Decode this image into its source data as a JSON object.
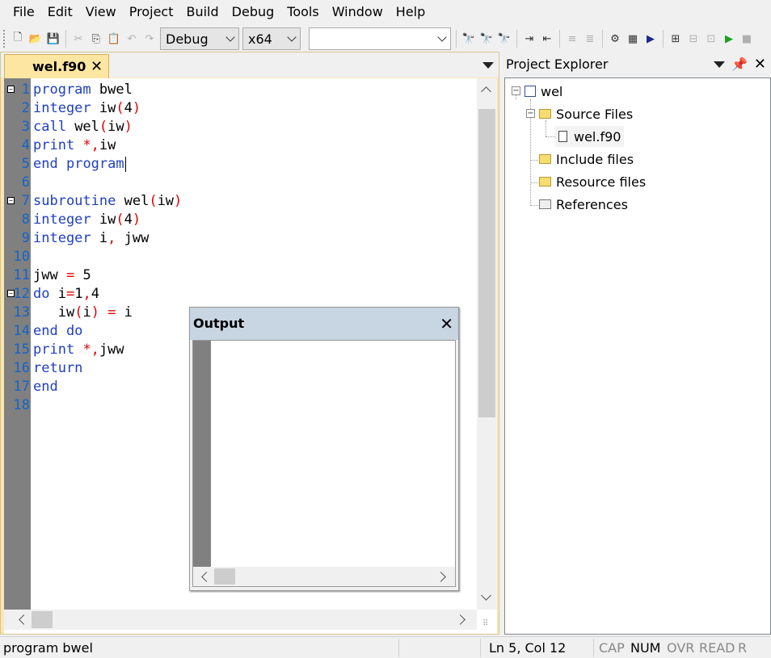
{
  "menu": [
    "File",
    "Edit",
    "View",
    "Project",
    "Build",
    "Debug",
    "Tools",
    "Window",
    "Help"
  ],
  "toolbar": {
    "configuration": "Debug",
    "platform": "x64",
    "find_value": ""
  },
  "editor": {
    "active_tab": "wel.f90",
    "lines": [
      {
        "n": "1",
        "tokens": [
          {
            "t": "program",
            "c": "kw"
          },
          {
            "t": " bwel",
            "c": ""
          }
        ],
        "fold": true
      },
      {
        "n": "2",
        "tokens": [
          {
            "t": "integer",
            "c": "kw"
          },
          {
            "t": " iw",
            "c": ""
          },
          {
            "t": "(",
            "c": "op"
          },
          {
            "t": "4",
            "c": ""
          },
          {
            "t": ")",
            "c": "op"
          }
        ]
      },
      {
        "n": "3",
        "tokens": [
          {
            "t": "call",
            "c": "kw"
          },
          {
            "t": " wel",
            "c": ""
          },
          {
            "t": "(",
            "c": "op"
          },
          {
            "t": "iw",
            "c": ""
          },
          {
            "t": ")",
            "c": "op"
          }
        ]
      },
      {
        "n": "4",
        "tokens": [
          {
            "t": "print",
            "c": "kw"
          },
          {
            "t": " ",
            "c": ""
          },
          {
            "t": "*,",
            "c": "op"
          },
          {
            "t": "iw",
            "c": ""
          }
        ]
      },
      {
        "n": "5",
        "tokens": [
          {
            "t": "end",
            "c": "kw"
          },
          {
            "t": " ",
            "c": ""
          },
          {
            "t": "program",
            "c": "kw"
          }
        ],
        "cursor": true
      },
      {
        "n": "6",
        "tokens": []
      },
      {
        "n": "7",
        "tokens": [
          {
            "t": "subroutine",
            "c": "kw"
          },
          {
            "t": " wel",
            "c": ""
          },
          {
            "t": "(",
            "c": "op"
          },
          {
            "t": "iw",
            "c": ""
          },
          {
            "t": ")",
            "c": "op"
          }
        ],
        "fold": true
      },
      {
        "n": "8",
        "tokens": [
          {
            "t": "integer",
            "c": "kw"
          },
          {
            "t": " iw",
            "c": ""
          },
          {
            "t": "(",
            "c": "op"
          },
          {
            "t": "4",
            "c": ""
          },
          {
            "t": ")",
            "c": "op"
          }
        ]
      },
      {
        "n": "9",
        "tokens": [
          {
            "t": "integer",
            "c": "kw"
          },
          {
            "t": " i",
            "c": ""
          },
          {
            "t": ",",
            "c": "op"
          },
          {
            "t": " jww",
            "c": ""
          }
        ]
      },
      {
        "n": "10",
        "tokens": []
      },
      {
        "n": "11",
        "tokens": [
          {
            "t": "jww ",
            "c": ""
          },
          {
            "t": "=",
            "c": "op"
          },
          {
            "t": " 5",
            "c": ""
          }
        ]
      },
      {
        "n": "12",
        "tokens": [
          {
            "t": "do",
            "c": "kw"
          },
          {
            "t": " i",
            "c": ""
          },
          {
            "t": "=",
            "c": "op"
          },
          {
            "t": "1",
            "c": ""
          },
          {
            "t": ",",
            "c": "op"
          },
          {
            "t": "4",
            "c": ""
          }
        ],
        "fold": true
      },
      {
        "n": "13",
        "tokens": [
          {
            "t": "   iw",
            "c": ""
          },
          {
            "t": "(",
            "c": "op"
          },
          {
            "t": "i",
            "c": ""
          },
          {
            "t": ")",
            "c": "op"
          },
          {
            "t": " ",
            "c": ""
          },
          {
            "t": "=",
            "c": "op"
          },
          {
            "t": " i",
            "c": ""
          }
        ]
      },
      {
        "n": "14",
        "tokens": [
          {
            "t": "end do",
            "c": "kw"
          }
        ]
      },
      {
        "n": "15",
        "tokens": [
          {
            "t": "print",
            "c": "kw"
          },
          {
            "t": " ",
            "c": ""
          },
          {
            "t": "*,",
            "c": "op"
          },
          {
            "t": "jww",
            "c": ""
          }
        ]
      },
      {
        "n": "16",
        "tokens": [
          {
            "t": "return",
            "c": "kw"
          }
        ]
      },
      {
        "n": "17",
        "tokens": [
          {
            "t": "end",
            "c": "kw"
          }
        ]
      },
      {
        "n": "18",
        "tokens": []
      }
    ]
  },
  "output": {
    "title": "Output",
    "close": "✕"
  },
  "explorer": {
    "title": "Project Explorer",
    "tree": {
      "project": "wel",
      "source_files": "Source Files",
      "source_file": "wel.f90",
      "include_files": "Include files",
      "resource_files": "Resource files",
      "references": "References"
    }
  },
  "statusbar": {
    "message": "program bwel",
    "position": "Ln 5, Col 12",
    "cap": "CAP",
    "num": "NUM",
    "ovr": "OVR",
    "read": "READ",
    "rec": "R"
  },
  "colors": {
    "keyword": "#1f3fbf",
    "operator": "#e00000",
    "line_number": "#1463c8",
    "gutter": "#808080",
    "tab_active": "#fce6a1"
  }
}
